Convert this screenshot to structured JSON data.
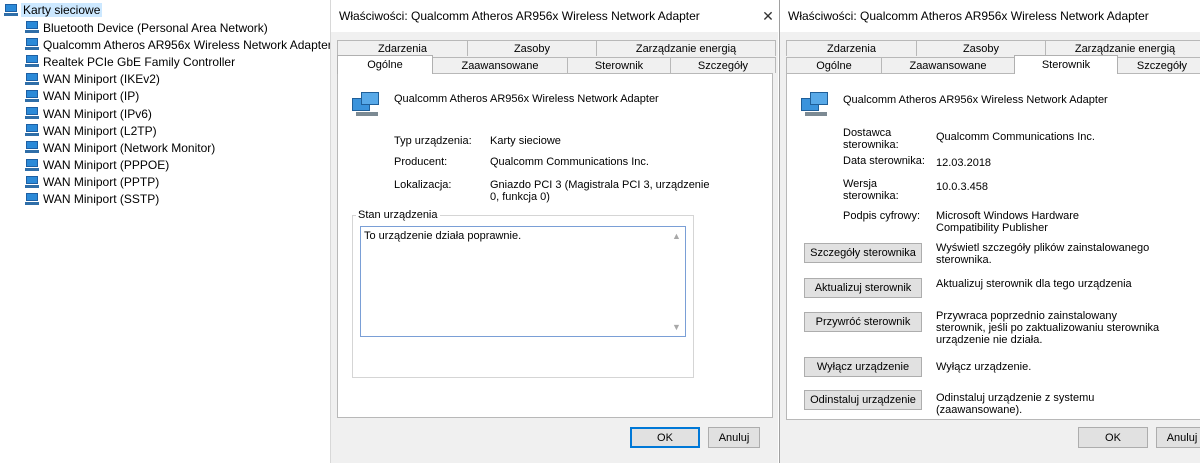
{
  "tree": {
    "root_label": "Karty sieciowe",
    "items": [
      "Bluetooth Device (Personal Area Network)",
      "Qualcomm Atheros AR956x Wireless Network Adapter",
      "Realtek PCIe GbE Family Controller",
      "WAN Miniport (IKEv2)",
      "WAN Miniport (IP)",
      "WAN Miniport (IPv6)",
      "WAN Miniport (L2TP)",
      "WAN Miniport (Network Monitor)",
      "WAN Miniport (PPPOE)",
      "WAN Miniport (PPTP)",
      "WAN Miniport (SSTP)"
    ]
  },
  "dialog1": {
    "title": "Właściwości: Qualcomm Atheros AR956x Wireless Network Adapter",
    "close_glyph": "✕",
    "tabs_back": [
      "Zdarzenia",
      "Zasoby",
      "Zarządzanie energią"
    ],
    "tabs_front": [
      "Ogólne",
      "Zaawansowane",
      "Sterownik",
      "Szczegóły"
    ],
    "device_name": "Qualcomm Atheros AR956x Wireless Network Adapter",
    "labels": {
      "type": "Typ urządzenia:",
      "producer": "Producent:",
      "location": "Lokalizacja:"
    },
    "values": {
      "type": "Karty sieciowe",
      "producer": "Qualcomm Communications Inc.",
      "location": "Gniazdo PCI 3 (Magistrala PCI 3, urządzenie 0, funkcja 0)"
    },
    "status_group": "Stan urządzenia",
    "status_text": "To urządzenie działa poprawnie.",
    "ok": "OK",
    "cancel": "Anuluj"
  },
  "dialog2": {
    "title": "Właściwości: Qualcomm Atheros AR956x Wireless Network Adapter",
    "tabs_back": [
      "Zdarzenia",
      "Zasoby",
      "Zarządzanie energią"
    ],
    "tabs_front": [
      "Ogólne",
      "Zaawansowane",
      "Sterownik",
      "Szczegóły"
    ],
    "device_name": "Qualcomm Atheros AR956x Wireless Network Adapter",
    "labels": {
      "provider": "Dostawca sterownika:",
      "date": "Data sterownika:",
      "version": "Wersja sterownika:",
      "signature": "Podpis cyfrowy:"
    },
    "values": {
      "provider": "Qualcomm Communications Inc.",
      "date": "12.03.2018",
      "version": "10.0.3.458",
      "signature": "Microsoft Windows Hardware Compatibility Publisher"
    },
    "buttons": {
      "details": "Szczegóły sterownika",
      "update": "Aktualizuj sterownik",
      "rollback": "Przywróć sterownik",
      "disable": "Wyłącz urządzenie",
      "uninstall": "Odinstaluj urządzenie"
    },
    "descriptions": {
      "details": "Wyświetl szczegóły plików zainstalowanego sterownika.",
      "update": "Aktualizuj sterownik dla tego urządzenia",
      "rollback": "Przywraca poprzednio zainstalowany sterownik, jeśli po zaktualizowaniu sterownika urządzenie nie działa.",
      "disable": "Wyłącz urządzenie.",
      "uninstall": "Odinstaluj urządzenie z systemu (zaawansowane)."
    },
    "ok": "OK",
    "cancel": "Anuluj"
  }
}
